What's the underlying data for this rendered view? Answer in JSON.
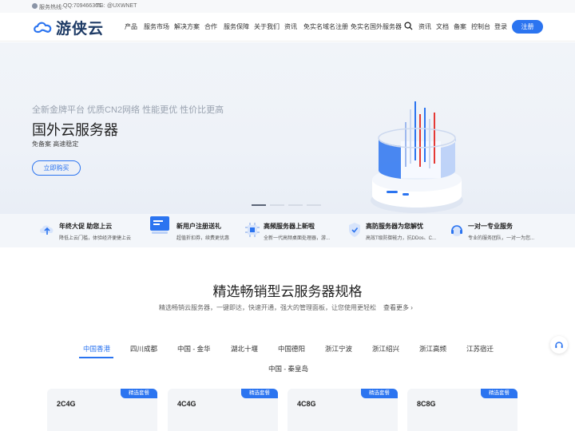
{
  "topbar": {
    "label": "服务热线:",
    "qq": "QQ:709466365",
    "tg_label": "TG:",
    "tg": "@UXWNET"
  },
  "header": {
    "logo_text": "游侠云",
    "nav": [
      "产品",
      "服务市场",
      "解决方案",
      "合作",
      "服务保障",
      "关于我们",
      "资讯",
      "免实名域名注册",
      "免实名国外服务器"
    ],
    "right_links": [
      "资讯",
      "文档",
      "备案",
      "控制台",
      "登录"
    ],
    "register": "注册"
  },
  "hero": {
    "subtitle": "全新金牌平台 优质CN2网络 性能更优 性价比更高",
    "title": "国外云服务器",
    "desc": "免备案 高速稳定",
    "button": "立即购买"
  },
  "features": [
    {
      "title": "年终大促 助您上云",
      "desc": "降低上云门槛，体验经济便捷上云",
      "icon": "cloud-upload-icon"
    },
    {
      "title": "新用户注册送礼",
      "desc": "超值折扣券，续费更优惠",
      "icon": "gift-card-icon"
    },
    {
      "title": "高频服务器上新啦",
      "desc": "全新一代高频桌面处理器，游...",
      "icon": "cpu-icon"
    },
    {
      "title": "高防服务器为您解忧",
      "desc": "高效T级防御能力，抗DDos、C...",
      "icon": "shield-icon"
    },
    {
      "title": "一对一专业服务",
      "desc": "专业的服务团队，一对一为您...",
      "icon": "headset-icon"
    }
  ],
  "section": {
    "title": "精选畅销型云服务器规格",
    "desc": "精选畅销云服务器，一键即达，快速开通，强大的管理面板，让您使用更轻松",
    "more": "查看更多"
  },
  "regions": [
    "中国香港",
    "四川成都",
    "中国 - 金华",
    "湖北十堰",
    "中国德阳",
    "浙江宁波",
    "浙江绍兴",
    "浙江高频",
    "江苏宿迁",
    "中国 - 秦皇岛"
  ],
  "active_region": "中国香港",
  "cards": [
    {
      "badge": "精选套餐",
      "name": "2C4G"
    },
    {
      "badge": "精选套餐",
      "name": "4C4G"
    },
    {
      "badge": "精选套餐",
      "name": "4C8G"
    },
    {
      "badge": "精选套餐",
      "name": "8C8G"
    }
  ],
  "colors": {
    "accent": "#2b74f0",
    "logo": "#1e3b66",
    "hero_bg": "#eef2f8"
  },
  "float_icon": "headset-icon"
}
